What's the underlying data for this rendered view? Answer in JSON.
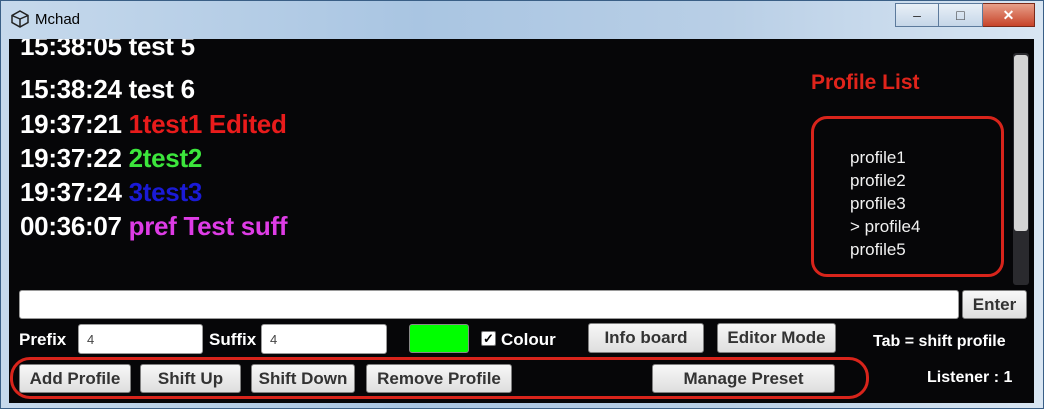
{
  "window": {
    "title": "Mchad",
    "controls": {
      "minimize": "–",
      "maximize": "□",
      "close": "✕"
    }
  },
  "log": [
    {
      "time": "15:38:05",
      "text": "test 5",
      "color": "#ffffff"
    },
    {
      "time": "15:38:24",
      "text": "test 6",
      "color": "#ffffff"
    },
    {
      "time": "19:37:21",
      "text": "1test1 Edited",
      "color": "#e81b1b"
    },
    {
      "time": "19:37:22",
      "text": "2test2",
      "color": "#3ce63c"
    },
    {
      "time": "19:37:24",
      "text": "3test3",
      "color": "#1a1ad6"
    },
    {
      "time": "00:36:07",
      "text": "pref Test suff",
      "color": "#de3ce6"
    }
  ],
  "profile_panel": {
    "title": "Profile List",
    "items": [
      "profile1",
      "profile2",
      "profile3",
      "> profile4",
      "profile5"
    ]
  },
  "input": {
    "value": "",
    "placeholder": ""
  },
  "controls": {
    "enter": "Enter",
    "prefix_label": "Prefix",
    "prefix_value": "4",
    "suffix_label": "Suffix",
    "suffix_value": "4",
    "colour_swatch": "#00ff00",
    "colour_label": "Colour",
    "colour_checked": true,
    "info_board": "Info board",
    "editor_mode": "Editor Mode",
    "tab_hint": "Tab = shift profile"
  },
  "profile_buttons": {
    "add": "Add Profile",
    "shift_up": "Shift Up",
    "shift_down": "Shift Down",
    "remove": "Remove Profile",
    "manage_preset": "Manage Preset",
    "listener": "Listener : 1"
  },
  "icons": {
    "app": "unity-icon",
    "check": "✓"
  },
  "colors": {
    "annotation": "#d8241b",
    "background": "#060608"
  }
}
